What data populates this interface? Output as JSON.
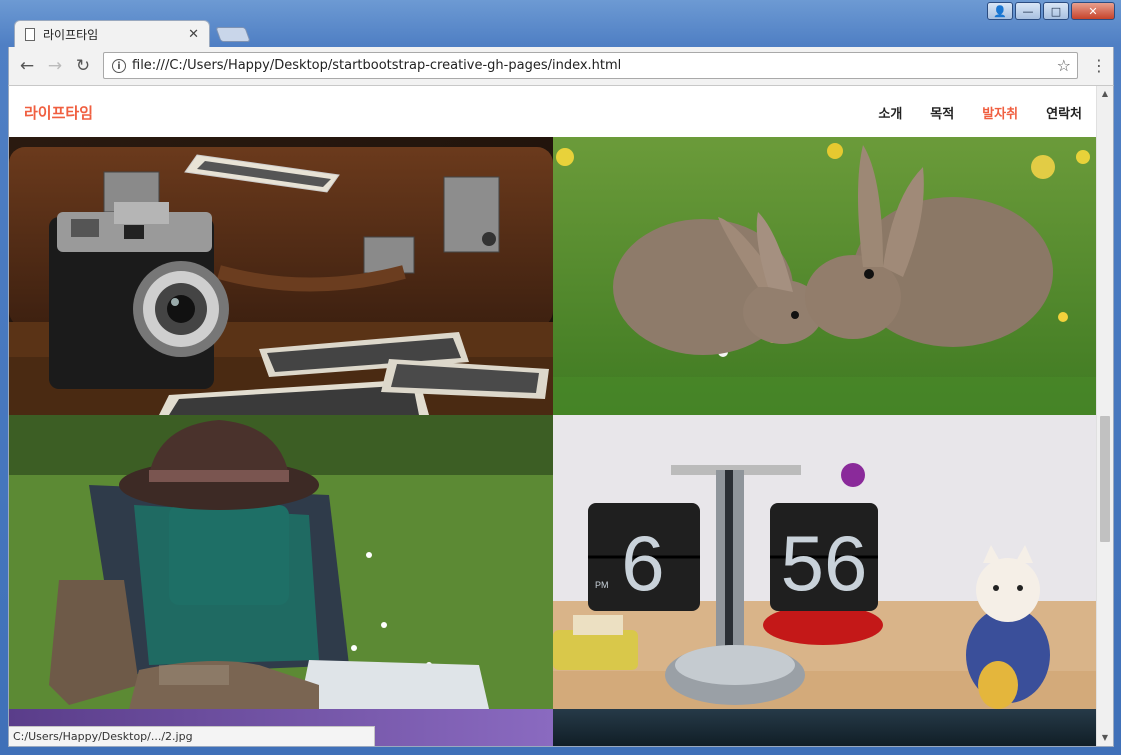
{
  "browser": {
    "tab_title": "라이프타임",
    "url": "file:///C:/Users/Happy/Desktop/startbootstrap-creative-gh-pages/index.html",
    "status_text": "C:/Users/Happy/Desktop/.../2.jpg"
  },
  "site": {
    "brand": "라이프타임",
    "nav": [
      "소개",
      "목적",
      "발자취",
      "연락처"
    ],
    "active_nav": "발자취",
    "accent_color": "#f05f40"
  },
  "portfolio": {
    "photos": [
      "camera-suitcase-photo",
      "rabbits-photo",
      "backpack-hat-boots-photo",
      "flip-clock-photo"
    ],
    "flip_clock": {
      "hour": "6",
      "minutes": "56",
      "meridiem": "PM"
    }
  }
}
